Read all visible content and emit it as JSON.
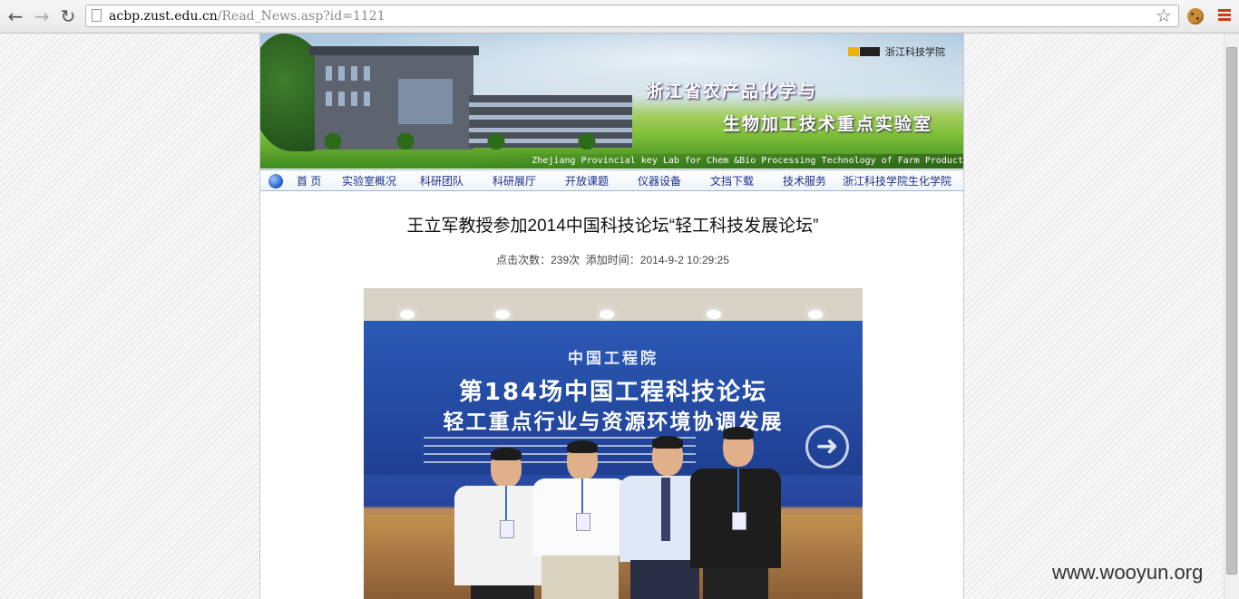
{
  "browser": {
    "url_host": "acbp.zust.edu.cn",
    "url_path": "/Read_News.asp?id=1121",
    "back_icon": "←",
    "forward_icon": "→",
    "reload_icon": "↻",
    "star_icon": "☆"
  },
  "banner": {
    "logo_text": "浙江科技学院",
    "title_line1": "浙江省农产品化学与",
    "title_line2": "生物加工技术重点实验室",
    "subtitle_en": "Zhejiang Provincial key Lab for Chem &Bio Processing Technology of Farm Product"
  },
  "nav": {
    "items": [
      {
        "label": "首 页"
      },
      {
        "label": "实验室概况"
      },
      {
        "label": "科研团队"
      },
      {
        "label": "科研展厅"
      },
      {
        "label": "开放课题"
      },
      {
        "label": "仪器设备"
      },
      {
        "label": "文挡下载"
      },
      {
        "label": "技术服务"
      },
      {
        "label": "浙江科技学院生化学院"
      }
    ]
  },
  "article": {
    "title": "王立军教授参加2014中国科技论坛“轻工科技发展论坛”",
    "meta": "点击次数：239次  添加时间：2014-9-2 10:29:25",
    "photo": {
      "org": "中国工程院",
      "line1": "第184场中国工程科技论坛",
      "line2": "轻工重点行业与资源环境协调发展",
      "arrow": "➜"
    }
  },
  "watermark": "www.wooyun.org"
}
